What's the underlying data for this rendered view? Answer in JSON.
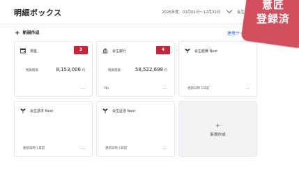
{
  "header": {
    "title": "明細ボックス",
    "period": "2025年度：01月01日〜12月31日",
    "account": "会生"
  },
  "stamp": {
    "line1": "意匠",
    "line2": "登録済"
  },
  "actions": {
    "new_label": "新規作成",
    "services_link": "連携サービス"
  },
  "cards": [
    {
      "name": "現金",
      "badge": "3",
      "balance_label": "残高残高",
      "balance": "8,153,006",
      "unit": "円",
      "more": "…"
    },
    {
      "name": "会生銀行",
      "badge": "4",
      "balance_label": "残高残高",
      "balance": "58,522,698",
      "unit": "円",
      "more": "…"
    },
    {
      "name": "会生経費 Next",
      "updated": "更新日時 1日前",
      "more": "…"
    },
    {
      "name": "会生請求 Next",
      "updated": "更新日時 1日前",
      "more": "…"
    },
    {
      "name": "会生証憑 Next",
      "updated": "更新日時 1日前",
      "more": "…"
    }
  ],
  "add_card": {
    "plus": "+",
    "label": "新規作成"
  },
  "colors": {
    "accent_red": "#c4243e",
    "link_blue": "#2f6fd4",
    "stamp": "#d24f5e"
  }
}
